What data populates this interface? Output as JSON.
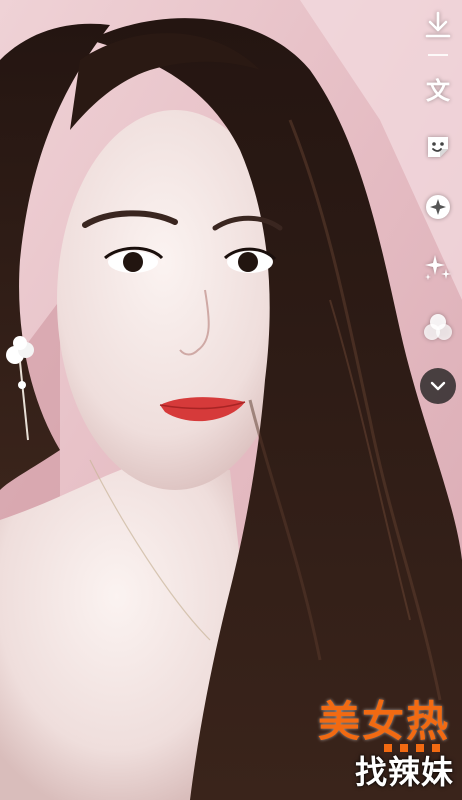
{
  "toolbar": {
    "download_icon": "download-icon",
    "text_label": "文",
    "sticker_icon": "sticker-icon",
    "effects_icon": "effects-icon",
    "sparkle_icon": "sparkle-icon",
    "filter_icon": "filter-circles-icon",
    "more_icon": "chevron-down-icon"
  },
  "watermark": {
    "line1": "美女热",
    "line2": "找辣妹",
    "accent_color": "#f26a12"
  },
  "colors": {
    "background": "#e9c9cf",
    "hair": "#2b1a14",
    "skin": "#f3e6e4",
    "lips": "#d63a3a"
  }
}
